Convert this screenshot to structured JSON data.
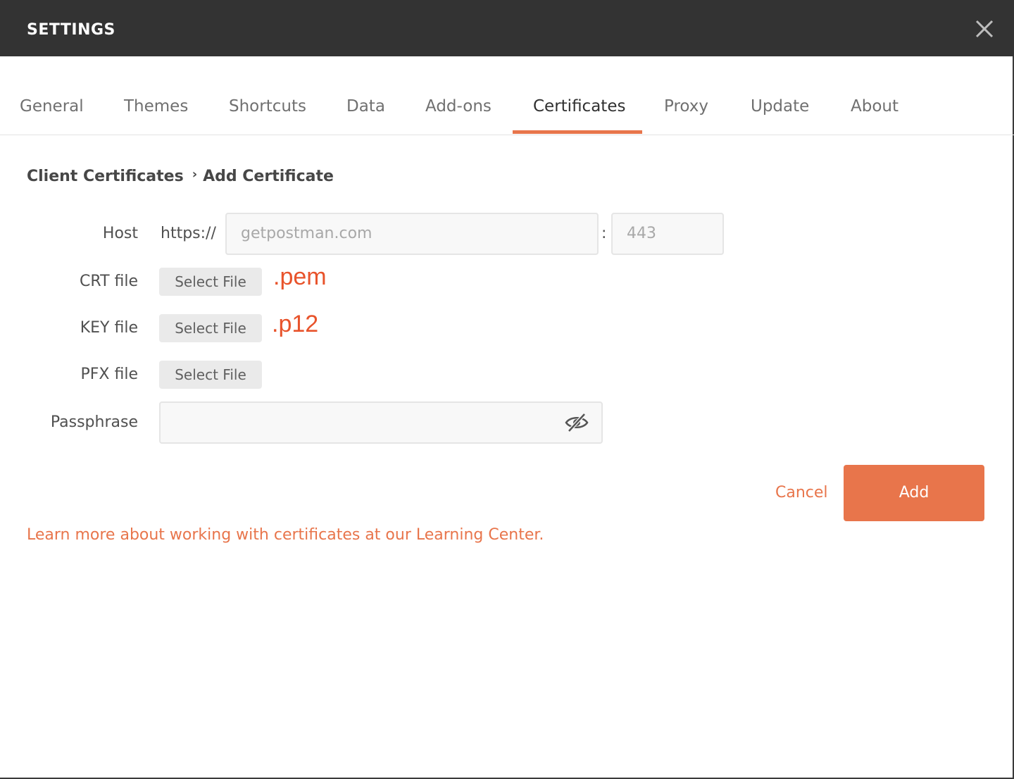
{
  "window": {
    "title": "SETTINGS",
    "close_icon": "close-icon"
  },
  "tabs": [
    {
      "label": "General",
      "active": false
    },
    {
      "label": "Themes",
      "active": false
    },
    {
      "label": "Shortcuts",
      "active": false
    },
    {
      "label": "Data",
      "active": false
    },
    {
      "label": "Add-ons",
      "active": false
    },
    {
      "label": "Certificates",
      "active": true
    },
    {
      "label": "Proxy",
      "active": false
    },
    {
      "label": "Update",
      "active": false
    },
    {
      "label": "About",
      "active": false
    }
  ],
  "breadcrumb": {
    "parent": "Client Certificates",
    "separator": "›",
    "current": "Add Certificate"
  },
  "form": {
    "host": {
      "label": "Host",
      "prefix": "https://",
      "host_placeholder": "getpostman.com",
      "separator": ":",
      "port_placeholder": "443"
    },
    "crt": {
      "label": "CRT file",
      "button": "Select File"
    },
    "key": {
      "label": "KEY file",
      "button": "Select File"
    },
    "pfx": {
      "label": "PFX file",
      "button": "Select File"
    },
    "passphrase": {
      "label": "Passphrase",
      "value": "",
      "toggle_icon": "eye-slash-icon"
    }
  },
  "annotations": {
    "crt": ".pem",
    "key": ".p12"
  },
  "actions": {
    "cancel": "Cancel",
    "add": "Add"
  },
  "learn_more": "Learn more about working with certificates at our Learning Center.",
  "colors": {
    "accent": "#e8754b",
    "titlebar": "#333333",
    "annotation": "#e8532b"
  }
}
